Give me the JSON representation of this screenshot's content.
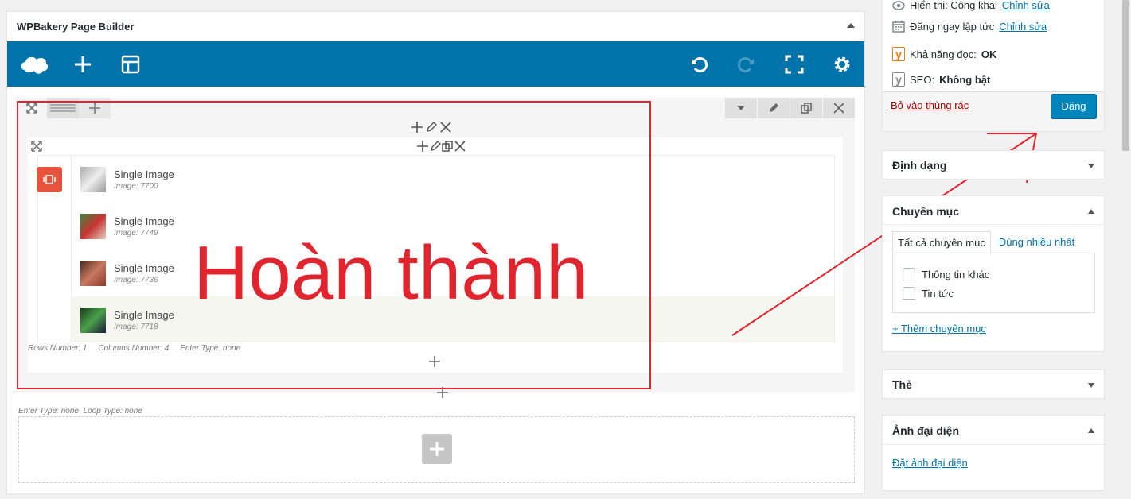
{
  "builder": {
    "title": "WPBakery Page Builder",
    "toolbar_icons": [
      "logo-icon",
      "add-element-icon",
      "templates-icon",
      "undo-icon",
      "redo-icon",
      "fullscreen-icon",
      "settings-icon"
    ],
    "items": [
      {
        "title": "Single Image",
        "sub": "Image: 7700"
      },
      {
        "title": "Single Image",
        "sub": "Image: 7749"
      },
      {
        "title": "Single Image",
        "sub": "Image: 7736"
      },
      {
        "title": "Single Image",
        "sub": "Image: 7718"
      }
    ],
    "row_meta": "Rows Number: 1     Columns Number: 4     Enter Type: none",
    "section_meta": "Enter Type: none  Loop Type: none"
  },
  "annotation": {
    "text": "Hoàn thành",
    "color": "#e1252f"
  },
  "publish": {
    "visibility_label": "Hiển thị: Công khai",
    "visibility_edit": "Chỉnh sửa",
    "schedule_label": "Đăng ngay lập tức",
    "schedule_edit": "Chỉnh sửa",
    "readability_label": "Khả năng đọc:",
    "readability_value": "OK",
    "seo_label": "SEO:",
    "seo_value": "Không bật",
    "trash": "Bỏ vào thùng rác",
    "publish_button": "Đăng"
  },
  "format_box": {
    "title": "Định dạng"
  },
  "category_box": {
    "title": "Chuyên mục",
    "tab_all": "Tất cả chuyên mục",
    "tab_popular": "Dùng nhiều nhất",
    "items": [
      "Thông tin khác",
      "Tin tức"
    ],
    "add_link": "+ Thêm chuyên mục"
  },
  "tag_box": {
    "title": "Thẻ"
  },
  "featured_box": {
    "title": "Ảnh đại diện",
    "link": "Đặt ảnh đại diện"
  },
  "colors": {
    "toolbar": "#0073aa",
    "publish": "#0085ba",
    "accent_red": "#e1252f"
  }
}
